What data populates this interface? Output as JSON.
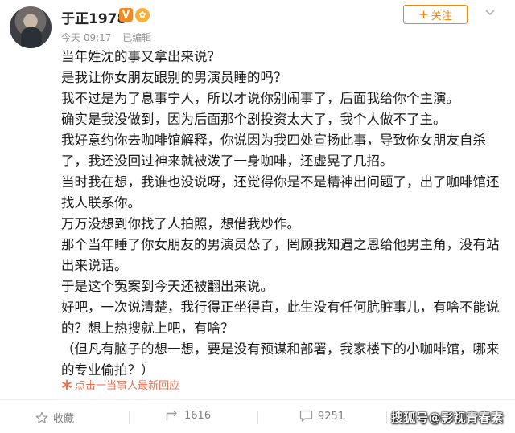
{
  "post": {
    "user_name": "于正1978",
    "vip_badge": "V",
    "fan_badge": "✿",
    "time": "今天 09:17",
    "edited": "已编辑",
    "follow_label": "关注",
    "lines": [
      "当年姓沈的事又拿出来说？",
      "是我让你女朋友跟别的男演员睡的吗？",
      "我不过是为了息事宁人，所以才说你别闹事了，后面我给你个主演。",
      "确实是我没做到，因为后面那个剧投资太大了，我个人做不了主。",
      "我好意约你去咖啡馆解释，你说因为我四处宣扬此事，导致你女朋友自杀了，我还没回过神来就被泼了一身咖啡，还虚晃了几招。",
      "当时我在想，我谁也没说呀，还觉得你是不是精神出问题了，出了咖啡馆还找人联系你。",
      "万万没想到你找了人拍照，想借我炒作。",
      "那个当年睡了你女朋友的男演员怂了，罔顾我知遇之恩给他男主角，没有站出来说话。",
      "于是这个冤案到今天还被翻出来说。",
      "好吧，一次说清楚，我行得正坐得直，此生没有任何肮脏事儿，有啥不能说的？想上热搜就上吧，有啥？",
      "（但凡有脑子的想一想，要是没有预谋和部署，我家楼下的小咖啡馆，哪来的专业偷拍？）"
    ],
    "reply_link": "点击一当事人最新回应"
  },
  "actions": {
    "favorite_label": "收藏",
    "repost_count": "1616",
    "comment_count": "9251"
  },
  "watermark": "搜狐号@影视青春素",
  "colors": {
    "accent": "#ff8200",
    "reply": "#eb7350",
    "meta": "#939393"
  }
}
